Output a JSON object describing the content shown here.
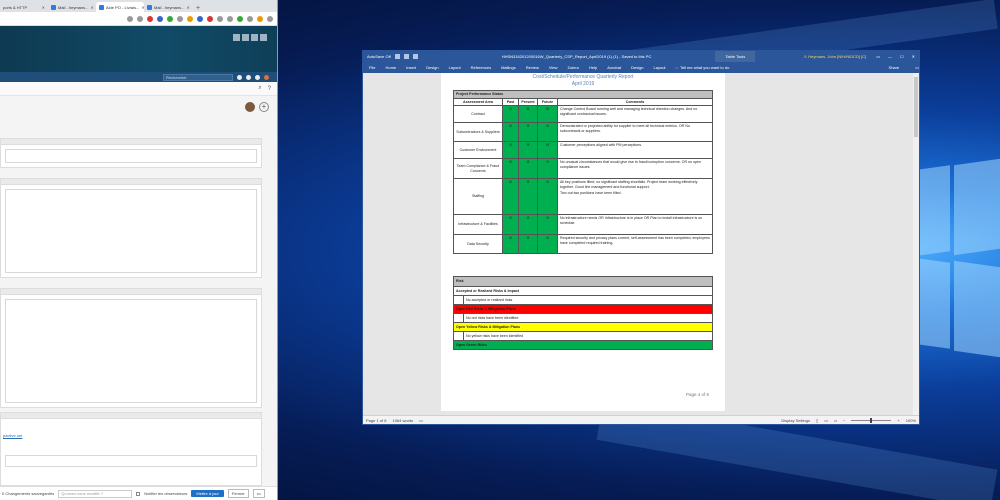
{
  "browser": {
    "tabs": [
      {
        "label": "ports & HTTP"
      },
      {
        "label": "Mail - heymans..."
      },
      {
        "label": "Aide PO - Livrais..."
      },
      {
        "label": "Mail - heymans..."
      }
    ],
    "new_tab": "+",
    "app_search_placeholder": "Rechercher",
    "link_text": "pactive.net",
    "statusbar": {
      "saved": "0 Changements sauvegardés",
      "comment_placeholder": "Qu'avez-vous modifié ?",
      "notify_label": "Notifier les observateurs",
      "update_button": "Mettre à jour",
      "close_button": "Fermer",
      "more": "•••"
    }
  },
  "word": {
    "title": {
      "autosave": "AutoSave  Off",
      "filename": "HHSN316201200016W_Quarterly_CSP_Report_April2019 (1) (1)  -  Saved to this PC",
      "tools": "Table Tools",
      "user": "⚠ Heymans, John [NIH/NIDCD] [C]"
    },
    "ribbon": [
      "File",
      "Home",
      "Insert",
      "Design",
      "Layout",
      "References",
      "Mailings",
      "Review",
      "View",
      "Zotero",
      "Help",
      "Acrobat",
      "Design",
      "Layout"
    ],
    "tellme": "Tell me what you want to do",
    "share": "Share",
    "document": {
      "title": "Cost/Schedule/Performance Quarterly Report",
      "date": "April 2019",
      "status_section": "Project Performance Status",
      "headers": [
        "Assessment Area",
        "Past",
        "Present",
        "Future",
        "Comments"
      ],
      "rows": [
        {
          "area": "Contract",
          "past": "G",
          "present": "G",
          "future": "G",
          "comment": "Change Control Board running well and managing technical direction changes. And no significant contractual issues."
        },
        {
          "area": "Subcontractors & Suppliers",
          "past": "G",
          "present": "G",
          "future": "G",
          "comment": "Demonstrated or projected ability for supplier to meet all technical metrics. OR No subcontracts or suppliers."
        },
        {
          "area": "Customer Environment",
          "past": "G",
          "present": "G",
          "future": "G",
          "comment": "Customer perceptions aligned with PM perceptions."
        },
        {
          "area": "Team Compliance & Fraud Concerns",
          "past": "G",
          "present": "G",
          "future": "G",
          "comment": "No unusual circumstances that would give rise to fraud/corruption concerns. OR no open compliance issues."
        },
        {
          "area": "Staffing",
          "past": "G",
          "present": "G",
          "future": "G",
          "comment": "All key positions filled; no significant staffing shortfalls. Project team working effectively together. Good line management and functional support.",
          "comment2": "Two out two positions have been filled."
        },
        {
          "area": "Infrastructure & Facilities",
          "past": "G",
          "present": "G",
          "future": "G",
          "comment": "No infrastructure needs OR Infrastructure is in place OR Plan to install infrastructure is on schedule."
        },
        {
          "area": "Data Security",
          "past": "G",
          "present": "G",
          "future": "G",
          "comment": "Required security and privacy plans current, self-assessment has been completed, employees have completed required training."
        }
      ],
      "risk": {
        "section": "Risk",
        "accepted_header": "Accepted or Realized Risks & Impact",
        "accepted_value": "No accepted or realized risks",
        "red_header": "Open Red Risks & Mitigation Plans",
        "red_value": "No red risks have been identified",
        "yellow_header": "Open Yellow Risks & Mitigation Plans",
        "yellow_value": "No yellow risks have been identified",
        "green_header": "Open Green Risks"
      },
      "page_number": "Page 4 of 6"
    },
    "status": {
      "page": "Page 1 of 6",
      "words": "1064 words",
      "display": "Display Settings",
      "zoom": "100%"
    }
  },
  "colors": {
    "word_blue": "#2b579a",
    "status_green": "#00b050",
    "risk_red": "#ff0000",
    "risk_yellow": "#ffff00"
  }
}
